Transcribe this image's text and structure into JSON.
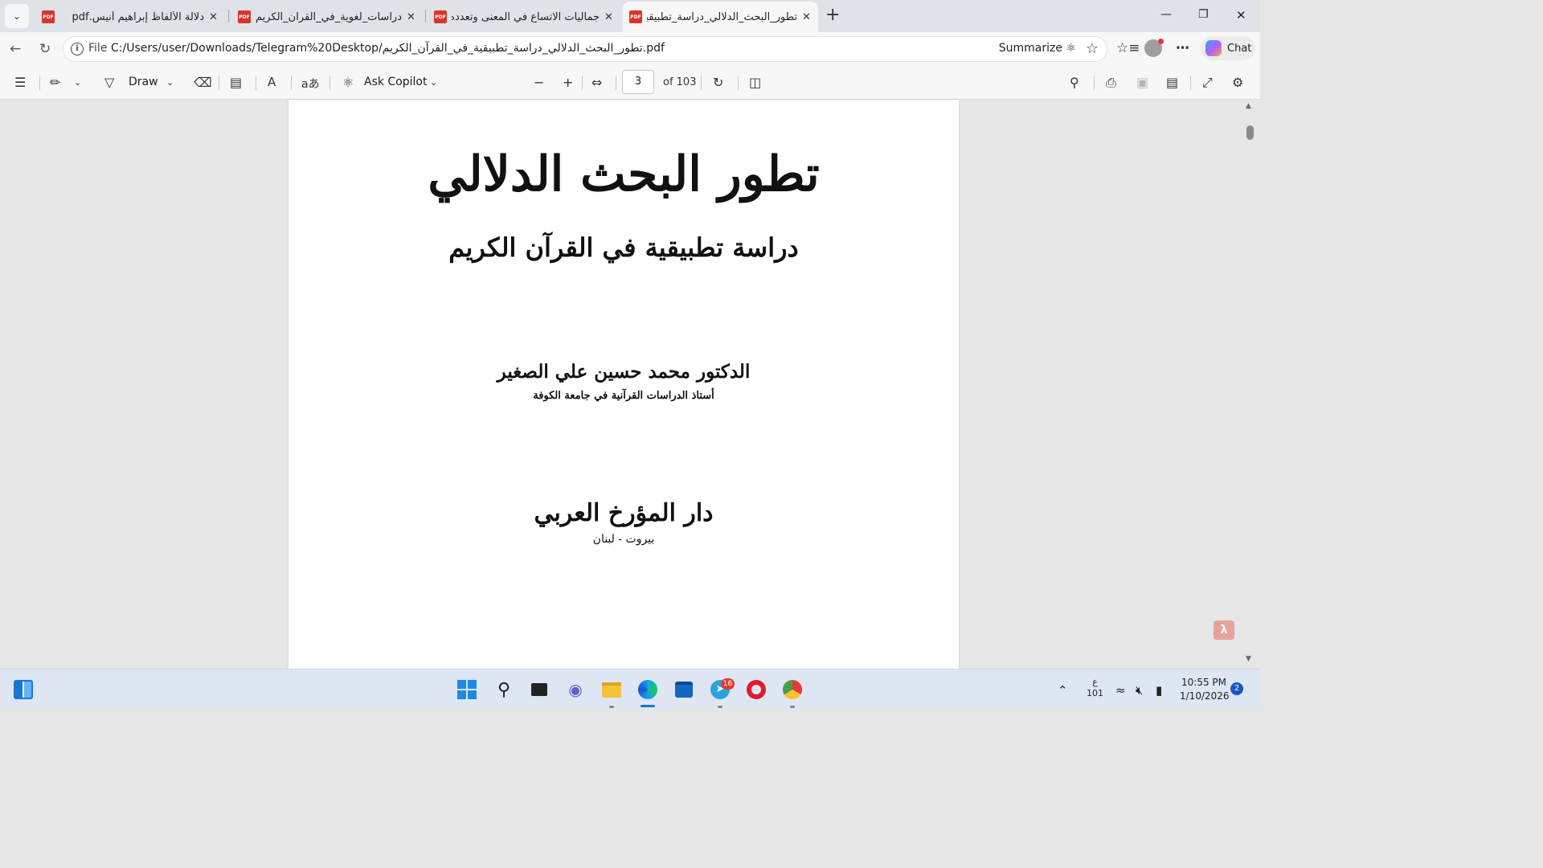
{
  "browser": {
    "tabs": [
      {
        "title": "دلالة الألفاظ إبراهيم أنيس.pdf",
        "active": false
      },
      {
        "title": "دراسات_لغوية_في_القرآن_الكريم_وقراءاته",
        "active": false
      },
      {
        "title": "جماليات الاتساع في المعنى وتعدده.pdf",
        "active": false
      },
      {
        "title": "تطور_البحث_الدلالي_دراسة_تطبيقية",
        "active": true
      }
    ],
    "favicon_label": "PDF",
    "address": {
      "scheme": "File",
      "url": "C:/Users/user/Downloads/Telegram%20Desktop/تطور_البحث_الدلالي_دراسة_تطبيقية_في_القرآن_الكريم.pdf",
      "summarize_label": "Summarize"
    },
    "chat_label": "Chat"
  },
  "pdf_toolbar": {
    "draw_label": "Draw",
    "ask_copilot_label": "Ask Copilot",
    "read_aloud_glyph": "A",
    "translate_glyph": "aあ",
    "current_page": "3",
    "page_count_label": "of 103"
  },
  "document": {
    "title": "تطور البحث الدلالي",
    "subtitle": "دراسة تطبيقية في القرآن الكريم",
    "author": "الدكتور محمد حسين علي الصغير",
    "author_role": "أستاذ الدراسات القرآنية في جامعة الكوفة",
    "publisher": "دار المؤرخ العربي",
    "publisher_city": "بيروت - لبنان"
  },
  "taskbar": {
    "telegram_badge": "16",
    "ime_char": "ع",
    "ime_code": "101",
    "time": "10:55 PM",
    "date": "1/10/2026",
    "notification_count": "2"
  }
}
